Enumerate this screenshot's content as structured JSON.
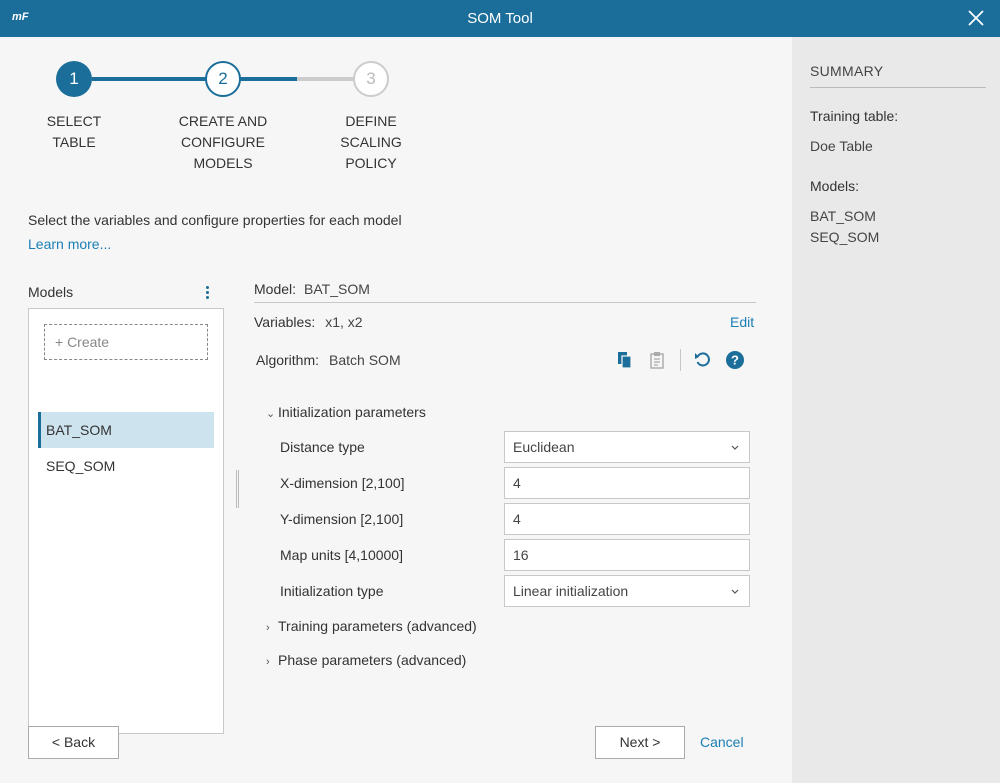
{
  "window": {
    "logo": "mF",
    "title": "SOM Tool"
  },
  "stepper": [
    {
      "number": "1",
      "label_lines": [
        "SELECT",
        "TABLE"
      ],
      "state": "done"
    },
    {
      "number": "2",
      "label_lines": [
        "CREATE AND",
        "CONFIGURE",
        "MODELS"
      ],
      "state": "current"
    },
    {
      "number": "3",
      "label_lines": [
        "DEFINE",
        "SCALING",
        "POLICY"
      ],
      "state": "future"
    }
  ],
  "description": "Select the variables and configure properties for each model",
  "learn_more": "Learn more...",
  "models": {
    "header": "Models",
    "create_label": "+ Create",
    "items": [
      "BAT_SOM",
      "SEQ_SOM"
    ],
    "selected": "BAT_SOM"
  },
  "model_detail": {
    "model_label": "Model:",
    "model_value": "BAT_SOM",
    "variables_label": "Variables:",
    "variables_value": "x1, x2",
    "edit_label": "Edit",
    "algorithm_label": "Algorithm:",
    "algorithm_value": "Batch SOM"
  },
  "sections": {
    "init": "Initialization parameters",
    "training": "Training parameters (advanced)",
    "phase": "Phase parameters (advanced)"
  },
  "params": {
    "distance_type": {
      "label": "Distance type",
      "value": "Euclidean"
    },
    "x_dimension": {
      "label": "X-dimension [2,100]",
      "value": "4"
    },
    "y_dimension": {
      "label": "Y-dimension [2,100]",
      "value": "4"
    },
    "map_units": {
      "label": "Map units [4,10000]",
      "value": "16"
    },
    "init_type": {
      "label": "Initialization type",
      "value": "Linear initialization"
    }
  },
  "buttons": {
    "back": "< Back",
    "next": "Next >",
    "cancel": "Cancel"
  },
  "summary": {
    "title": "SUMMARY",
    "training_table_label": "Training table:",
    "training_table_value": "Doe Table",
    "models_label": "Models:",
    "models": [
      "BAT_SOM",
      "SEQ_SOM"
    ]
  },
  "colors": {
    "accent": "#1b6e9a",
    "link": "#1b7fb5",
    "selected_bg": "#cde3ee"
  }
}
